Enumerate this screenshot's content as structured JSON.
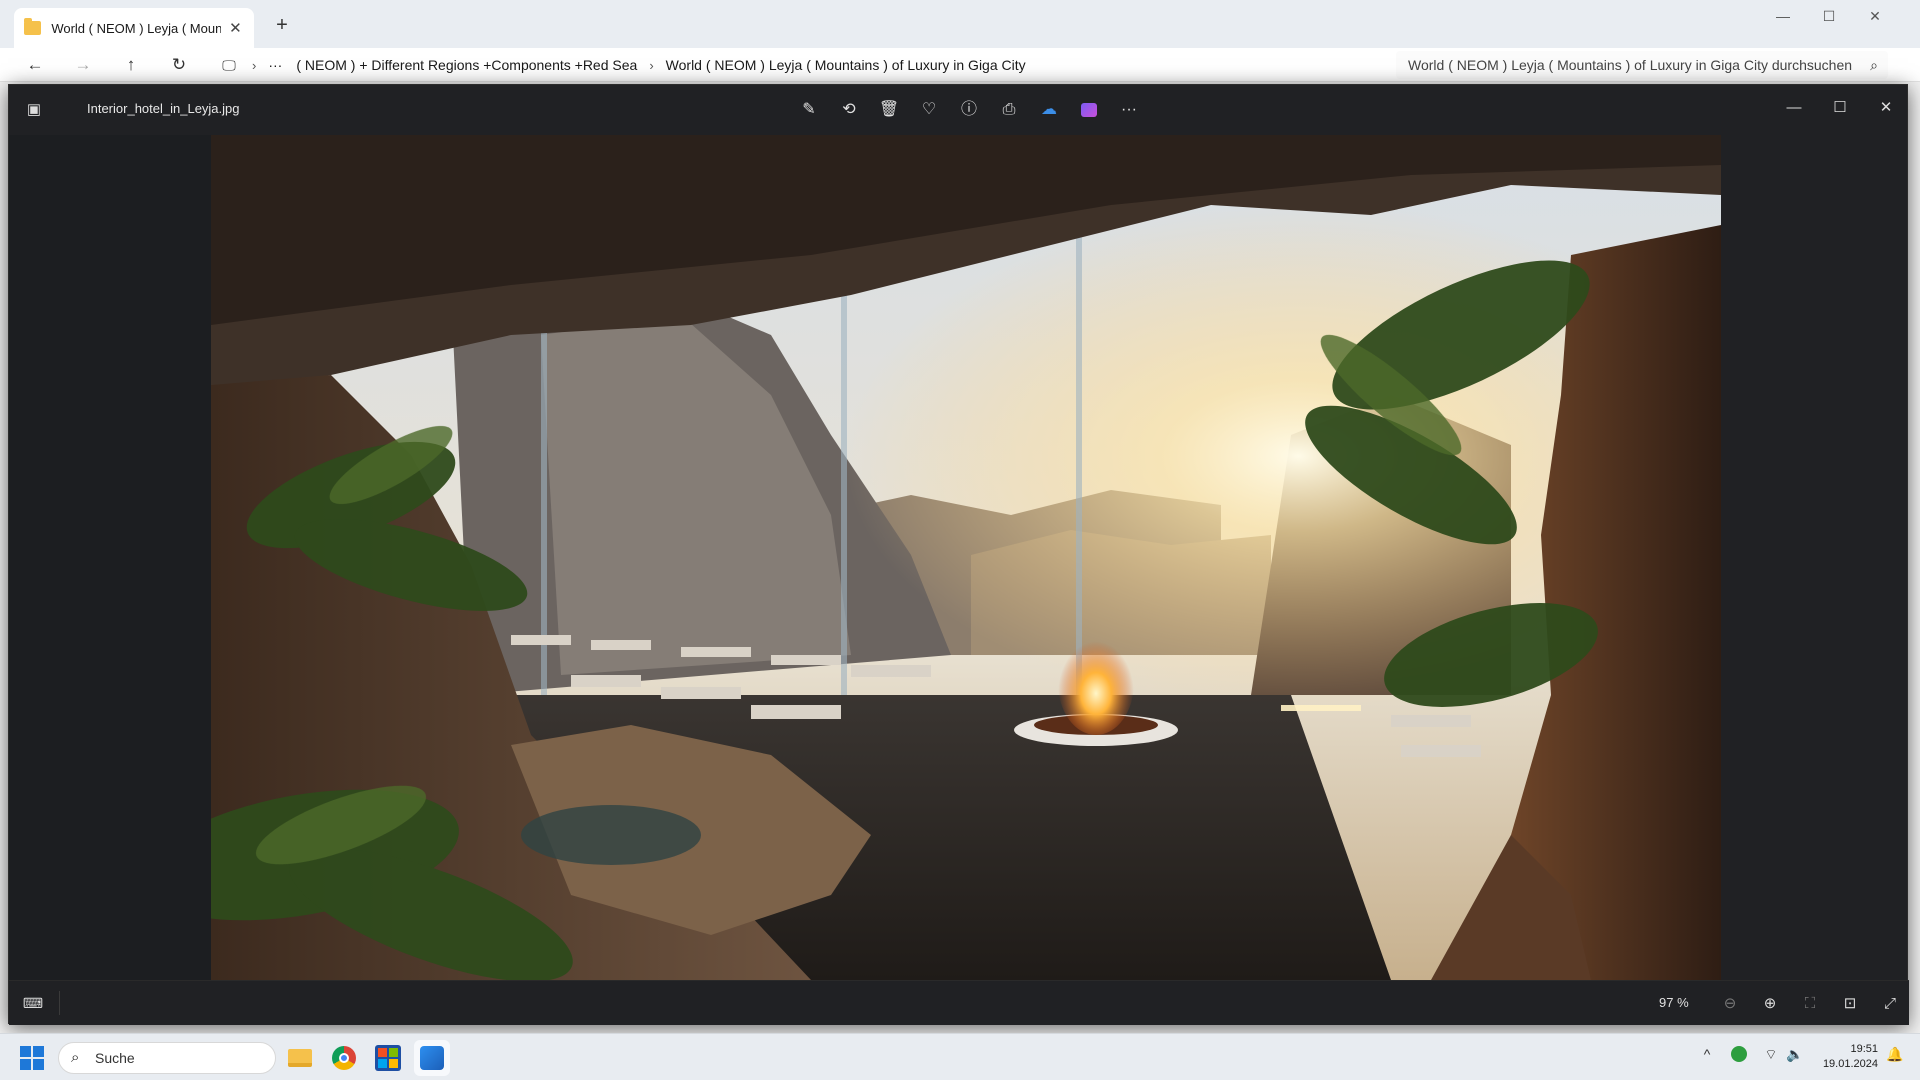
{
  "explorer": {
    "tab_title": "World ( NEOM ) Leyja ( Mount",
    "new_tab_label": "+",
    "breadcrumb": [
      "( NEOM ) + Different Regions +Components +Red Sea",
      "World ( NEOM ) Leyja ( Mountains ) of Luxury in Giga City"
    ],
    "search_placeholder": "World ( NEOM ) Leyja ( Mountains ) of Luxury in Giga City durchsuchen"
  },
  "viewer": {
    "file_name": "Interior_hotel_in_Leyja.jpg",
    "zoom_level": "97 %",
    "toolbar_icons": [
      "edit-icon",
      "rotate-icon",
      "delete-icon",
      "favorite-icon",
      "info-icon",
      "print-icon",
      "onedrive-icon",
      "clipchamp-icon",
      "more-icon"
    ]
  },
  "taskbar": {
    "search_label": "Suche",
    "time": "19:51",
    "date": "19.01.2024"
  },
  "colors": {
    "accent": "#1e78d8",
    "viewer_bg": "#202124",
    "folder": "#f5c14b"
  }
}
